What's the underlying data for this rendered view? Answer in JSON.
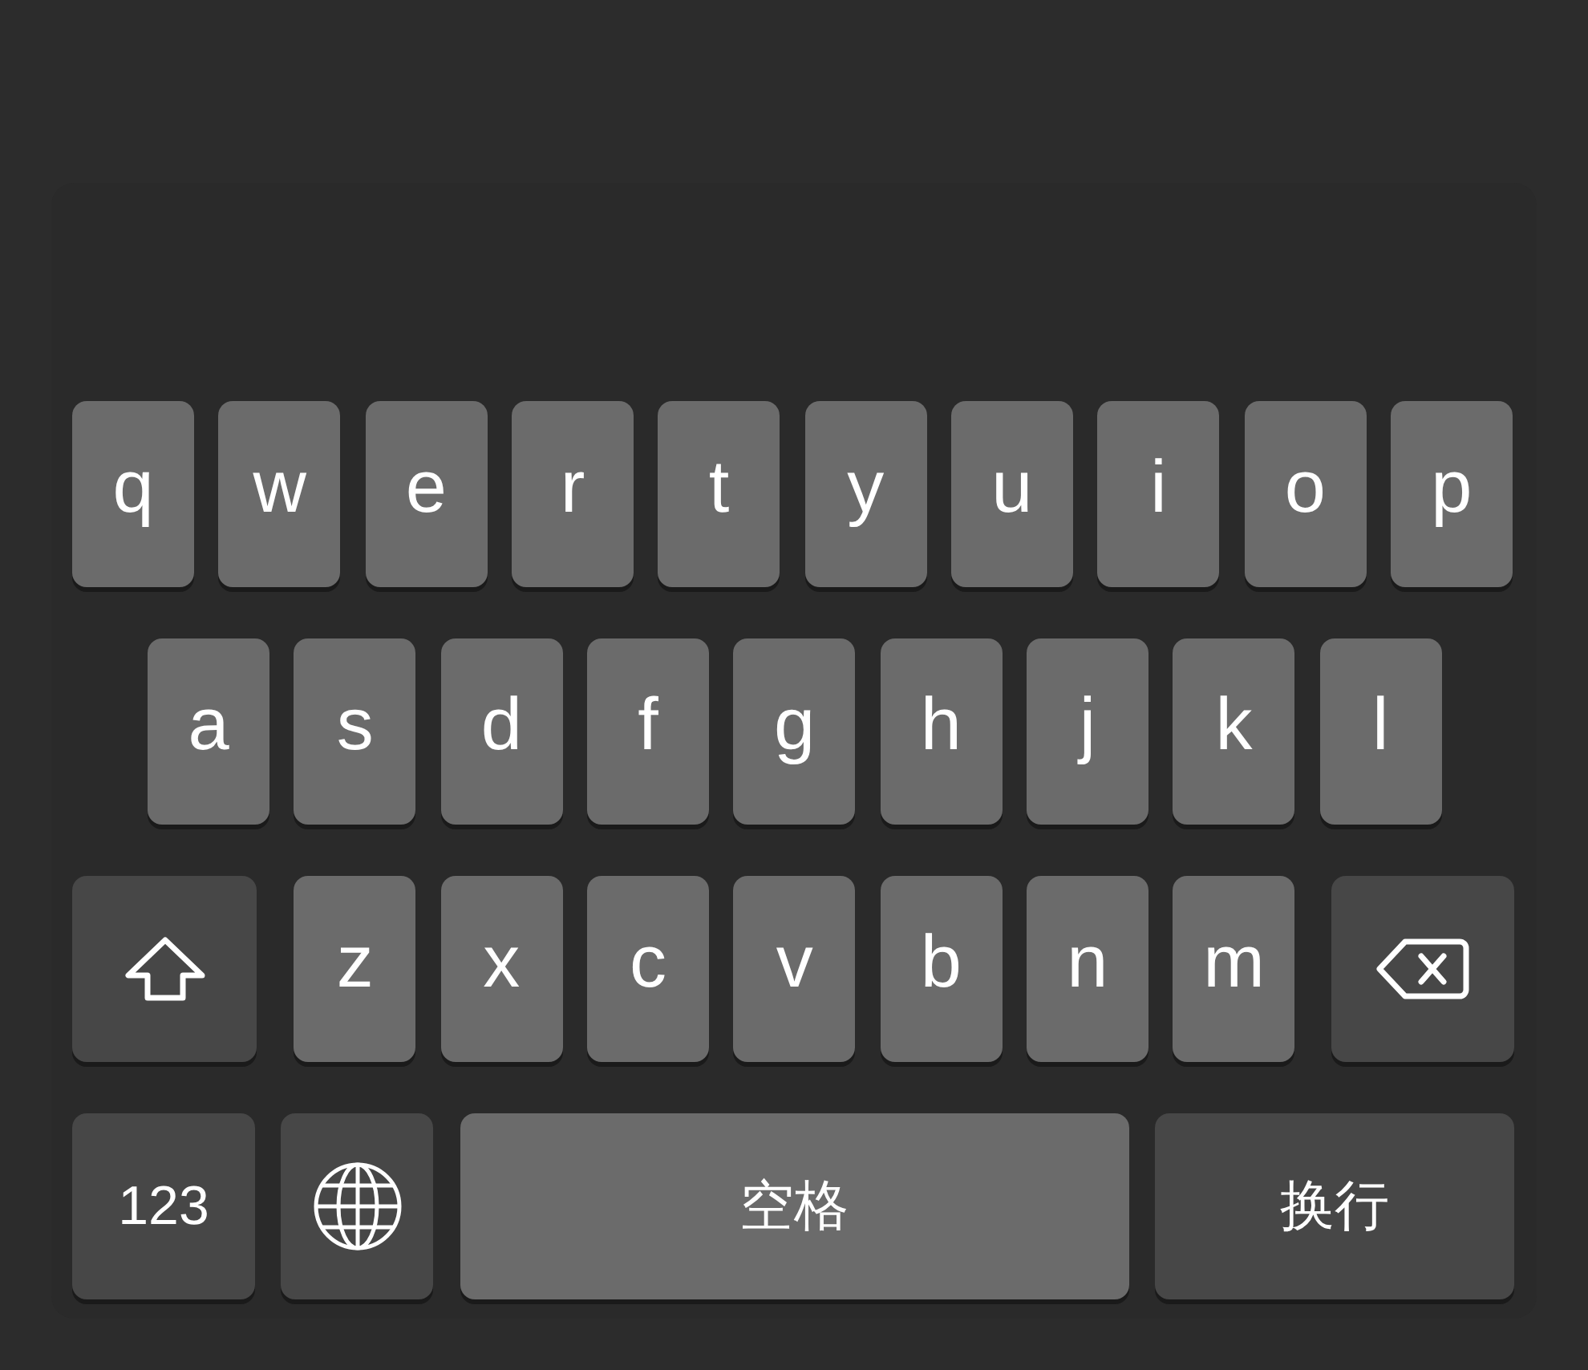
{
  "keyboard": {
    "rows": [
      {
        "keys": [
          {
            "kind": "letter",
            "label": "q"
          },
          {
            "kind": "letter",
            "label": "w"
          },
          {
            "kind": "letter",
            "label": "e"
          },
          {
            "kind": "letter",
            "label": "r"
          },
          {
            "kind": "letter",
            "label": "t"
          },
          {
            "kind": "letter",
            "label": "y"
          },
          {
            "kind": "letter",
            "label": "u"
          },
          {
            "kind": "letter",
            "label": "i"
          },
          {
            "kind": "letter",
            "label": "o"
          },
          {
            "kind": "letter",
            "label": "p"
          }
        ]
      },
      {
        "keys": [
          {
            "kind": "letter",
            "label": "a"
          },
          {
            "kind": "letter",
            "label": "s"
          },
          {
            "kind": "letter",
            "label": "d"
          },
          {
            "kind": "letter",
            "label": "f"
          },
          {
            "kind": "letter",
            "label": "g"
          },
          {
            "kind": "letter",
            "label": "h"
          },
          {
            "kind": "letter",
            "label": "j"
          },
          {
            "kind": "letter",
            "label": "k"
          },
          {
            "kind": "letter",
            "label": "l"
          }
        ]
      },
      {
        "keys": [
          {
            "kind": "shift"
          },
          {
            "kind": "letter",
            "label": "z"
          },
          {
            "kind": "letter",
            "label": "x"
          },
          {
            "kind": "letter",
            "label": "c"
          },
          {
            "kind": "letter",
            "label": "v"
          },
          {
            "kind": "letter",
            "label": "b"
          },
          {
            "kind": "letter",
            "label": "n"
          },
          {
            "kind": "letter",
            "label": "m"
          },
          {
            "kind": "delete"
          }
        ]
      },
      {
        "keys": [
          {
            "kind": "numbers",
            "label": "123"
          },
          {
            "kind": "globe"
          },
          {
            "kind": "space",
            "label": "空格"
          },
          {
            "kind": "return",
            "label": "换行"
          }
        ]
      }
    ]
  }
}
